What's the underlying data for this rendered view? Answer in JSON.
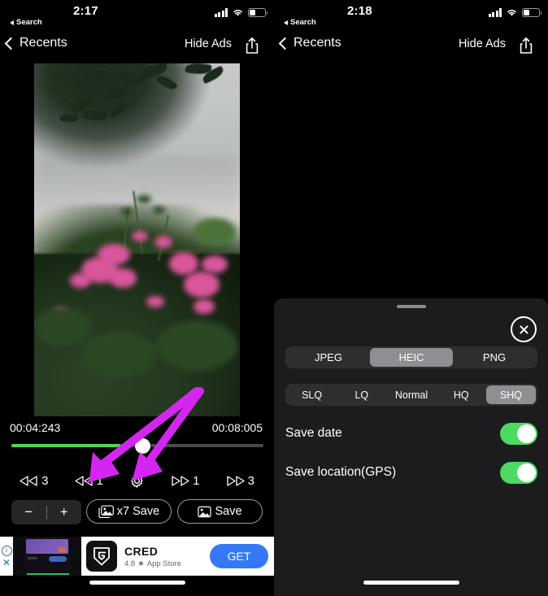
{
  "left": {
    "status": {
      "time": "2:17",
      "back_app": "Search",
      "battery_icon": "battery-icon",
      "wifi_icon": "wifi-icon",
      "cellular_icon": "cellular-bars-icon"
    },
    "nav": {
      "back_label": "Recents",
      "hide_ads_label": "Hide Ads",
      "share_icon": "share-icon"
    },
    "player": {
      "current_time": "00:04:243",
      "total_time": "00:08:005",
      "progress_percent": 43,
      "transport": [
        {
          "icon": "rewind-icon",
          "label": "3",
          "name": "rewind-3-button"
        },
        {
          "icon": "rewind-icon",
          "label": "1",
          "name": "rewind-1-button"
        },
        {
          "icon": "gear-icon",
          "label": "",
          "name": "settings-gear-button"
        },
        {
          "icon": "forward-icon",
          "label": "1",
          "name": "forward-1-button"
        },
        {
          "icon": "forward-icon",
          "label": "3",
          "name": "forward-3-button"
        }
      ]
    },
    "actions": {
      "minus_label": "−",
      "plus_label": "+",
      "multi_save_label": "x7 Save",
      "multi_save_icon": "photo-stack-icon",
      "single_save_label": "Save",
      "single_save_icon": "photo-icon"
    },
    "ad": {
      "info_icon": "info-icon",
      "close_icon": "close-icon",
      "app_name": "CRED",
      "rating": "4.8",
      "star_icon": "star-icon",
      "store": "App Store",
      "cta_label": "GET"
    }
  },
  "right": {
    "status": {
      "time": "2:18",
      "back_app": "Search",
      "battery_icon": "battery-icon",
      "wifi_icon": "wifi-icon",
      "cellular_icon": "cellular-bars-icon"
    },
    "nav": {
      "back_label": "Recents",
      "hide_ads_label": "Hide Ads",
      "share_icon": "share-icon"
    },
    "sheet": {
      "close_icon": "close-circle-icon",
      "format": {
        "options": [
          "JPEG",
          "HEIC",
          "PNG"
        ],
        "selected": "HEIC"
      },
      "quality": {
        "options": [
          "SLQ",
          "LQ",
          "Normal",
          "HQ",
          "SHQ"
        ],
        "selected": "SHQ"
      },
      "toggles": [
        {
          "label": "Save date",
          "on": true
        },
        {
          "label": "Save location(GPS)",
          "on": true
        }
      ]
    }
  },
  "annotation": {
    "color": "#d426f0",
    "arrow_count": 2,
    "targets": [
      "rewind-1-button",
      "settings-gear-button"
    ]
  }
}
